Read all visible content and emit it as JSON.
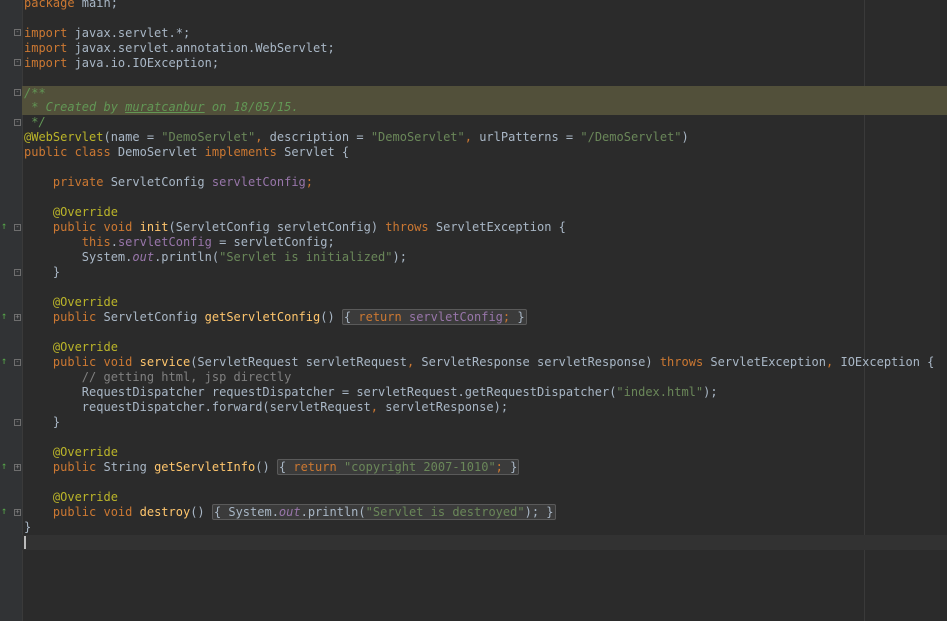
{
  "editor": {
    "lines": {
      "l0": {
        "t0": "package",
        "t1": " main;"
      },
      "l2": {
        "t0": "import",
        "t1": " javax.servlet.*;"
      },
      "l3": {
        "t0": "import",
        "t1": " javax.servlet.annotation.WebServlet;"
      },
      "l4": {
        "t0": "import",
        "t1": " java.io.IOException;"
      },
      "l6": {
        "t0": "/**"
      },
      "l7": {
        "t0": " * Created by ",
        "t1": "muratcanbur",
        "t2": " on 18/05/15."
      },
      "l8": {
        "t0": " */"
      },
      "l9": {
        "t0": "@WebServlet",
        "t1": "(name = ",
        "t2": "\"DemoServlet\"",
        "t3": ", ",
        "t4": "description",
        "t5": " = ",
        "t6": "\"DemoServlet\"",
        "t7": ", ",
        "t8": "urlPatterns",
        "t9": " = ",
        "t10": "\"/DemoServlet\"",
        "t11": ")"
      },
      "l10": {
        "t0": "public class",
        "t1": " DemoServlet ",
        "t2": "implements",
        "t3": " Servlet {"
      },
      "l12": {
        "t0": "private",
        "t1": " ServletConfig ",
        "t2": "servletConfig",
        "t3": ";"
      },
      "l14": {
        "t0": "@Override"
      },
      "l15": {
        "t0": "public void",
        "t1": " ",
        "t2": "init",
        "t3": "(ServletConfig servletConfig) ",
        "t4": "throws",
        "t5": " ServletException {"
      },
      "l16": {
        "t0": "this",
        "t1": ".",
        "t2": "servletConfig",
        "t3": " = servletConfig;"
      },
      "l17": {
        "t0": "System.",
        "t1": "out",
        "t2": ".println(",
        "t3": "\"Servlet is initialized\"",
        "t4": ");"
      },
      "l18": {
        "t0": "}"
      },
      "l20": {
        "t0": "@Override"
      },
      "l21": {
        "t0": "public",
        "t1": " ServletConfig ",
        "t2": "getServletConfig",
        "t3": "() ",
        "t4": "{ ",
        "t5": "return",
        "t6": " ",
        "t7": "servletConfig",
        "t8": ";",
        "t9": " }"
      },
      "l23": {
        "t0": "@Override"
      },
      "l24": {
        "t0": "public void",
        "t1": " ",
        "t2": "service",
        "t3": "(ServletRequest servletRequest",
        "t4": ", ",
        "t5": "ServletResponse servletResponse) ",
        "t6": "throws",
        "t7": " ServletException",
        "t8": ", ",
        "t9": "IOException {"
      },
      "l25": {
        "t0": "// getting html, jsp directly"
      },
      "l26": {
        "t0": "RequestDispatcher requestDispatcher = servletRequest.getRequestDispatcher(",
        "t1": "\"index.html\"",
        "t2": ");"
      },
      "l27": {
        "t0": "requestDispatcher.forward(servletRequest",
        "t1": ", ",
        "t2": "servletResponse);"
      },
      "l28": {
        "t0": "}"
      },
      "l30": {
        "t0": "@Override"
      },
      "l31": {
        "t0": "public",
        "t1": " String ",
        "t2": "getServletInfo",
        "t3": "() ",
        "t4": "{ ",
        "t5": "return",
        "t6": " ",
        "t7": "\"copyright 2007-1010\"",
        "t8": ";",
        "t9": " }"
      },
      "l33": {
        "t0": "@Override"
      },
      "l34": {
        "t0": "public void",
        "t1": " ",
        "t2": "destroy",
        "t3": "() ",
        "t4": "{ ",
        "t5": "System.",
        "t6": "out",
        "t7": ".println(",
        "t8": "\"Servlet is destroyed\"",
        "t9": ");",
        "t10": " }"
      },
      "l35": {
        "t0": "}"
      }
    },
    "colors": {
      "background": "#2b2b2b",
      "keyword": "#cc7832",
      "string": "#6a8759",
      "annotation": "#bbb529",
      "field": "#9876aa",
      "method": "#ffc66d",
      "comment": "#808080",
      "doc_comment": "#629755",
      "default": "#a9b7c6"
    },
    "gutter_icons": {
      "fold": "fold-icon",
      "override": "override-method-icon"
    }
  }
}
